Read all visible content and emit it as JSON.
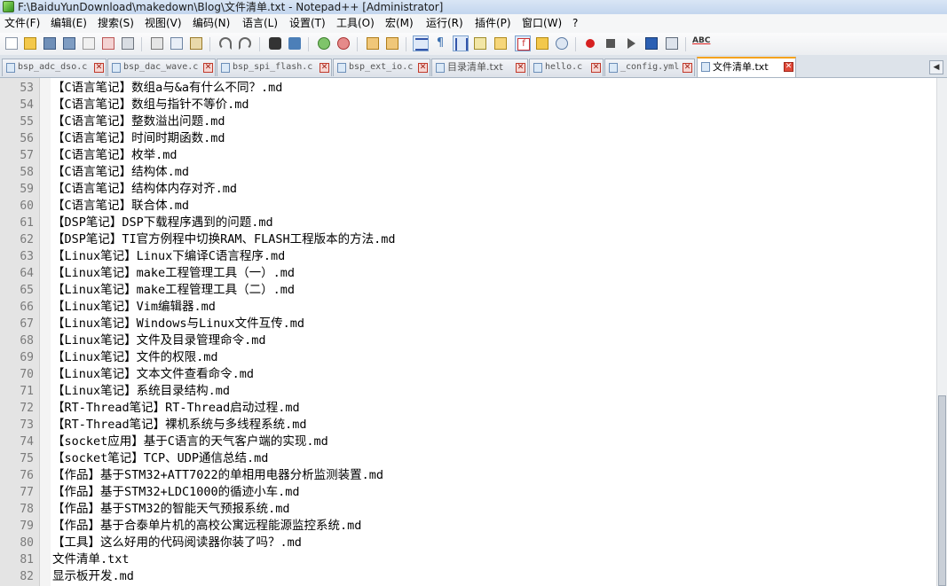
{
  "window": {
    "title": "F:\\BaiduYunDownload\\makedown\\Blog\\文件清单.txt - Notepad++ [Administrator]"
  },
  "menu": [
    "文件(F)",
    "编辑(E)",
    "搜索(S)",
    "视图(V)",
    "编码(N)",
    "语言(L)",
    "设置(T)",
    "工具(O)",
    "宏(M)",
    "运行(R)",
    "插件(P)",
    "窗口(W)",
    "?"
  ],
  "toolbar": {
    "icons": [
      "new-file-icon",
      "open-file-icon",
      "save-icon",
      "save-all-icon",
      "close-icon",
      "close-all-icon",
      "print-icon",
      "cut-icon",
      "copy-icon",
      "paste-icon",
      "undo-icon",
      "redo-icon",
      "find-icon",
      "replace-icon",
      "zoom-in-icon",
      "zoom-out-icon",
      "sync-vertical-icon",
      "sync-horizontal-icon",
      "word-wrap-icon",
      "show-all-chars-icon",
      "indent-guide-icon",
      "udl-icon",
      "doc-map-icon",
      "function-list-icon",
      "folder-workspace-icon",
      "monitor-icon",
      "record-macro-icon",
      "stop-macro-icon",
      "play-macro-icon",
      "run-macro-multiple-icon",
      "save-macro-icon",
      "spellcheck-icon"
    ],
    "spellcheck_label": "ABC"
  },
  "tabs": [
    {
      "label": "bsp_adc_dso.c",
      "active": false
    },
    {
      "label": "bsp_dac_wave.c",
      "active": false
    },
    {
      "label": "bsp_spi_flash.c",
      "active": false
    },
    {
      "label": "bsp_ext_io.c",
      "active": false
    },
    {
      "label": "目录清单.txt",
      "active": false
    },
    {
      "label": "hello.c",
      "active": false
    },
    {
      "label": "_config.yml",
      "active": false
    },
    {
      "label": "文件清单.txt",
      "active": true
    }
  ],
  "tab_scroll": {
    "left": "◀",
    "right": "▶"
  },
  "editor": {
    "lines": [
      {
        "n": "53",
        "text": "【C语言笔记】数组a与&a有什么不同？.md"
      },
      {
        "n": "54",
        "text": "【C语言笔记】数组与指针不等价.md"
      },
      {
        "n": "55",
        "text": "【C语言笔记】整数溢出问题.md"
      },
      {
        "n": "56",
        "text": "【C语言笔记】时间时期函数.md"
      },
      {
        "n": "57",
        "text": "【C语言笔记】枚举.md"
      },
      {
        "n": "58",
        "text": "【C语言笔记】结构体.md"
      },
      {
        "n": "59",
        "text": "【C语言笔记】结构体内存对齐.md"
      },
      {
        "n": "60",
        "text": "【C语言笔记】联合体.md"
      },
      {
        "n": "61",
        "text": "【DSP笔记】DSP下载程序遇到的问题.md"
      },
      {
        "n": "62",
        "text": "【DSP笔记】TI官方例程中切换RAM、FLASH工程版本的方法.md"
      },
      {
        "n": "63",
        "text": "【Linux笔记】Linux下编译C语言程序.md"
      },
      {
        "n": "64",
        "text": "【Linux笔记】make工程管理工具（一）.md"
      },
      {
        "n": "65",
        "text": "【Linux笔记】make工程管理工具（二）.md"
      },
      {
        "n": "66",
        "text": "【Linux笔记】Vim编辑器.md"
      },
      {
        "n": "67",
        "text": "【Linux笔记】Windows与Linux文件互传.md"
      },
      {
        "n": "68",
        "text": "【Linux笔记】文件及目录管理命令.md"
      },
      {
        "n": "69",
        "text": "【Linux笔记】文件的权限.md"
      },
      {
        "n": "70",
        "text": "【Linux笔记】文本文件查看命令.md"
      },
      {
        "n": "71",
        "text": "【Linux笔记】系统目录结构.md"
      },
      {
        "n": "72",
        "text": "【RT-Thread笔记】RT-Thread启动过程.md"
      },
      {
        "n": "73",
        "text": "【RT-Thread笔记】裸机系统与多线程系统.md"
      },
      {
        "n": "74",
        "text": "【socket应用】基于C语言的天气客户端的实现.md"
      },
      {
        "n": "75",
        "text": "【socket笔记】TCP、UDP通信总结.md"
      },
      {
        "n": "76",
        "text": "【作品】基于STM32+ATT7022的单相用电器分析监测装置.md"
      },
      {
        "n": "77",
        "text": "【作品】基于STM32+LDC1000的循迹小车.md"
      },
      {
        "n": "78",
        "text": "【作品】基于STM32的智能天气预报系统.md"
      },
      {
        "n": "79",
        "text": "【作品】基于合泰单片机的高校公寓远程能源监控系统.md"
      },
      {
        "n": "80",
        "text": "【工具】这么好用的代码阅读器你装了吗？.md"
      },
      {
        "n": "81",
        "text": "文件清单.txt"
      },
      {
        "n": "82",
        "text": "显示板开发.md"
      }
    ]
  },
  "colors": {
    "active_tab_accent": "#f4a21e",
    "gutter_bg": "#e4e4e4",
    "close_red": "#c0392b"
  }
}
